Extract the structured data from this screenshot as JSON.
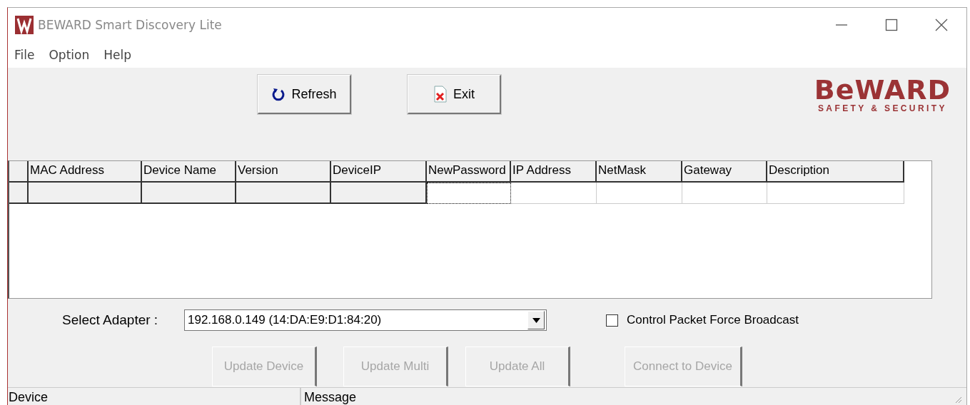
{
  "window": {
    "title": "BEWARD Smart Discovery Lite"
  },
  "menu": [
    {
      "label": "File"
    },
    {
      "label": "Option"
    },
    {
      "label": "Help"
    }
  ],
  "toolbar": [
    {
      "label": "Refresh",
      "kind": "refresh"
    },
    {
      "label": "Exit",
      "kind": "exit"
    }
  ],
  "logo": {
    "name": "BeWARD",
    "tagline": "SAFETY & SECURITY"
  },
  "grid": {
    "columns": [
      {
        "label": "MAC Address",
        "editable": false,
        "focused": false
      },
      {
        "label": "Device Name",
        "editable": false,
        "focused": false
      },
      {
        "label": "Version",
        "editable": false,
        "focused": false
      },
      {
        "label": "DeviceIP",
        "editable": false,
        "focused": false
      },
      {
        "label": "NewPassword",
        "editable": true,
        "focused": true
      },
      {
        "label": "IP Address",
        "editable": true,
        "focused": false
      },
      {
        "label": "NetMask",
        "editable": true,
        "focused": false
      },
      {
        "label": "Gateway",
        "editable": true,
        "focused": false
      },
      {
        "label": "Description",
        "editable": true,
        "focused": false
      }
    ]
  },
  "adapter": {
    "label": "Select Adapter :",
    "value": "192.168.0.149 (14:DA:E9:D1:84:20)"
  },
  "broadcast": {
    "label": "Control Packet Force Broadcast",
    "checked": false
  },
  "actions": [
    {
      "label": "Update Device",
      "disabled": true
    },
    {
      "label": "Update Multi",
      "disabled": true
    },
    {
      "label": "Update All",
      "disabled": true
    },
    {
      "label": "Connect to Device",
      "disabled": true
    }
  ],
  "status_bar": [
    {
      "label": "Device"
    },
    {
      "label": "Message"
    }
  ]
}
